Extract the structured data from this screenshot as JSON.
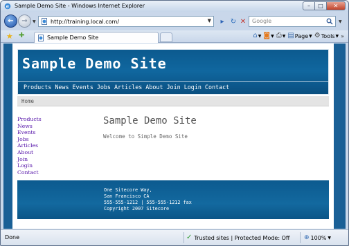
{
  "window": {
    "title": "Sample Demo Site - Windows Internet Explorer"
  },
  "address": {
    "url": "http://training.local.com/"
  },
  "search": {
    "placeholder": "Google"
  },
  "tab": {
    "label": "Sample Demo Site"
  },
  "commandbar": {
    "page_label": "Page",
    "tools_label": "Tools"
  },
  "site": {
    "title": "Sample Demo Site",
    "nav": [
      "Products",
      "News",
      "Events",
      "Jobs",
      "Articles",
      "About",
      "Join",
      "Login",
      "Contact"
    ],
    "breadcrumb": "Home",
    "leftnav": [
      "Products",
      "News",
      "Events",
      "Jobs",
      "Articles",
      "About",
      "Join",
      "Login",
      "Contact"
    ],
    "main_title": "Sample Demo Site",
    "main_text": "Welcome to Simple Demo Site",
    "footer": [
      "One Sitecore Way,",
      "San Francisco CA",
      "555-555-1212 | 555-555-1212 fax",
      "Copyright 2007 Sitecore"
    ]
  },
  "status": {
    "text": "Done",
    "zone": "Trusted sites | Protected Mode: Off",
    "zoom": "100%"
  },
  "icons": {
    "back": "back-arrow-icon",
    "forward": "forward-arrow-icon",
    "refresh": "refresh-icon",
    "stop": "stop-icon",
    "search": "search-icon",
    "favorites": "favorites-star-icon",
    "add_favorite": "add-favorite-icon",
    "home": "home-icon",
    "feeds": "rss-icon",
    "print": "print-icon"
  },
  "colors": {
    "header_blue": "#0c5a8f",
    "page_side_blue": "#2376b1",
    "nav_link": "#5311a8",
    "breadcrumb_bg": "#e4e4e4"
  }
}
